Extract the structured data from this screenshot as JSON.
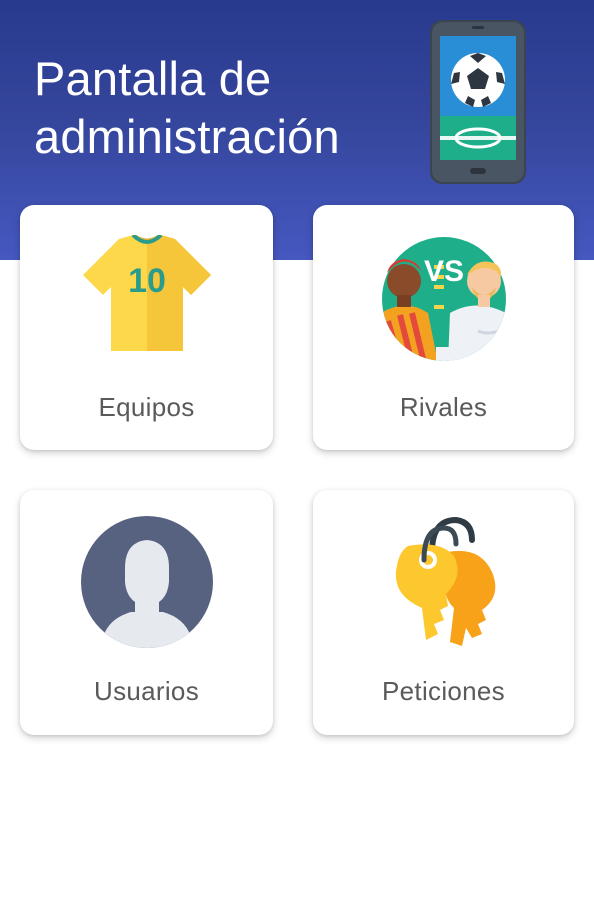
{
  "header": {
    "title_line1": "Pantalla de",
    "title_line2": "administración",
    "icon": "phone-soccer-icon"
  },
  "menu": [
    {
      "label": "Equipos",
      "icon": "jersey-icon",
      "jersey_number": "10"
    },
    {
      "label": "Rivales",
      "icon": "versus-icon",
      "vs_text": "VS"
    },
    {
      "label": "Usuarios",
      "icon": "user-avatar-icon"
    },
    {
      "label": "Peticiones",
      "icon": "keys-icon"
    }
  ],
  "colors": {
    "header_top": "#283a8e",
    "header_bottom": "#4658c0",
    "label_text": "#5a5a5a",
    "jersey_yellow": "#fdd84a",
    "jersey_number": "#2a9c8c",
    "key_yellow": "#fdc72e",
    "avatar_bg": "#576280"
  }
}
